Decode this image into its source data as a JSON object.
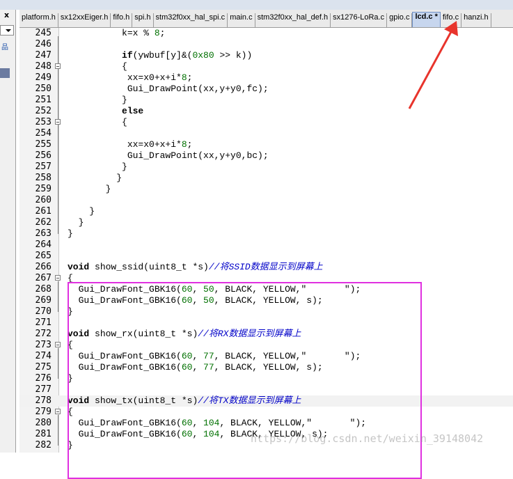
{
  "left_panel": {
    "close_glyph": "x",
    "icon_glyph": "品"
  },
  "tabs": [
    {
      "label": "platform.h",
      "active": false
    },
    {
      "label": "sx12xxEiger.h",
      "active": false
    },
    {
      "label": "fifo.h",
      "active": false
    },
    {
      "label": "spi.h",
      "active": false
    },
    {
      "label": "stm32f0xx_hal_spi.c",
      "active": false
    },
    {
      "label": "main.c",
      "active": false
    },
    {
      "label": "stm32f0xx_hal_def.h",
      "active": false
    },
    {
      "label": "sx1276-LoRa.c",
      "active": false
    },
    {
      "label": "gpio.c",
      "active": false
    },
    {
      "label": "lcd.c *",
      "active": true
    },
    {
      "label": "fifo.c",
      "active": false
    },
    {
      "label": "hanzi.h",
      "active": false
    }
  ],
  "lines": [
    {
      "n": "245",
      "fold": false,
      "t": [
        [
          "",
          "          k=x % "
        ],
        [
          "num",
          "8"
        ],
        [
          "",
          ";"
        ]
      ]
    },
    {
      "n": "246",
      "fold": false,
      "t": []
    },
    {
      "n": "247",
      "fold": false,
      "t": [
        [
          "",
          "          "
        ],
        [
          "kw",
          "if"
        ],
        [
          "",
          "(ywbuf[y]&("
        ],
        [
          "num",
          "0x80"
        ],
        [
          "",
          " >> k))"
        ]
      ]
    },
    {
      "n": "248",
      "fold": true,
      "t": [
        [
          "",
          "          {"
        ]
      ]
    },
    {
      "n": "249",
      "fold": false,
      "t": [
        [
          "",
          "           xx=x0+x+i*"
        ],
        [
          "num",
          "8"
        ],
        [
          "",
          ";"
        ]
      ]
    },
    {
      "n": "250",
      "fold": false,
      "t": [
        [
          "",
          "           Gui_DrawPoint(xx,y+y0,fc);"
        ]
      ]
    },
    {
      "n": "251",
      "fold": false,
      "t": [
        [
          "",
          "          }"
        ]
      ]
    },
    {
      "n": "252",
      "fold": false,
      "t": [
        [
          "",
          "          "
        ],
        [
          "kw",
          "else"
        ]
      ]
    },
    {
      "n": "253",
      "fold": true,
      "t": [
        [
          "",
          "          {"
        ]
      ]
    },
    {
      "n": "254",
      "fold": false,
      "t": []
    },
    {
      "n": "255",
      "fold": false,
      "t": [
        [
          "",
          "           xx=x0+x+i*"
        ],
        [
          "num",
          "8"
        ],
        [
          "",
          ";"
        ]
      ]
    },
    {
      "n": "256",
      "fold": false,
      "t": [
        [
          "",
          "           Gui_DrawPoint(xx,y+y0,bc);"
        ]
      ]
    },
    {
      "n": "257",
      "fold": false,
      "t": [
        [
          "",
          "          }"
        ]
      ]
    },
    {
      "n": "258",
      "fold": false,
      "t": [
        [
          "",
          "         }"
        ]
      ]
    },
    {
      "n": "259",
      "fold": false,
      "t": [
        [
          "",
          "       }"
        ]
      ]
    },
    {
      "n": "260",
      "fold": false,
      "t": []
    },
    {
      "n": "261",
      "fold": false,
      "t": [
        [
          "",
          "    }"
        ]
      ]
    },
    {
      "n": "262",
      "fold": false,
      "t": [
        [
          "",
          "  }"
        ]
      ]
    },
    {
      "n": "263",
      "fold": false,
      "t": [
        [
          "",
          "}"
        ]
      ]
    },
    {
      "n": "264",
      "fold": false,
      "t": []
    },
    {
      "n": "265",
      "fold": false,
      "t": []
    },
    {
      "n": "266",
      "fold": false,
      "t": [
        [
          "kw",
          "void"
        ],
        [
          "",
          " show_ssid(uint8_t *s)"
        ],
        [
          "cm",
          "//将SSID数据显示到屏幕上"
        ]
      ]
    },
    {
      "n": "267",
      "fold": true,
      "t": [
        [
          "",
          "{"
        ]
      ]
    },
    {
      "n": "268",
      "fold": false,
      "t": [
        [
          "",
          "  Gui_DrawFont_GBK16("
        ],
        [
          "num",
          "60"
        ],
        [
          "",
          ", "
        ],
        [
          "num",
          "50"
        ],
        [
          "",
          ", BLACK, YELLOW,\"       \");"
        ]
      ]
    },
    {
      "n": "269",
      "fold": false,
      "t": [
        [
          "",
          "  Gui_DrawFont_GBK16("
        ],
        [
          "num",
          "60"
        ],
        [
          "",
          ", "
        ],
        [
          "num",
          "50"
        ],
        [
          "",
          ", BLACK, YELLOW, s);"
        ]
      ]
    },
    {
      "n": "270",
      "fold": false,
      "t": [
        [
          "",
          "}"
        ]
      ]
    },
    {
      "n": "271",
      "fold": false,
      "t": []
    },
    {
      "n": "272",
      "fold": false,
      "t": [
        [
          "kw",
          "void"
        ],
        [
          "",
          " show_rx(uint8_t *s)"
        ],
        [
          "cm",
          "//将RX数据显示到屏幕上"
        ]
      ]
    },
    {
      "n": "273",
      "fold": true,
      "t": [
        [
          "",
          "{"
        ]
      ]
    },
    {
      "n": "274",
      "fold": false,
      "t": [
        [
          "",
          "  Gui_DrawFont_GBK16("
        ],
        [
          "num",
          "60"
        ],
        [
          "",
          ", "
        ],
        [
          "num",
          "77"
        ],
        [
          "",
          ", BLACK, YELLOW,\"       \");"
        ]
      ]
    },
    {
      "n": "275",
      "fold": false,
      "t": [
        [
          "",
          "  Gui_DrawFont_GBK16("
        ],
        [
          "num",
          "60"
        ],
        [
          "",
          ", "
        ],
        [
          "num",
          "77"
        ],
        [
          "",
          ", BLACK, YELLOW, s);"
        ]
      ]
    },
    {
      "n": "276",
      "fold": false,
      "t": [
        [
          "",
          "}"
        ]
      ]
    },
    {
      "n": "277",
      "fold": false,
      "t": []
    },
    {
      "n": "278",
      "fold": false,
      "cur": true,
      "t": [
        [
          "kw",
          "void"
        ],
        [
          "",
          " show_tx(uint8_t *s)"
        ],
        [
          "cm",
          "//将TX数据显示到屏幕上"
        ]
      ]
    },
    {
      "n": "279",
      "fold": true,
      "t": [
        [
          "",
          "{"
        ]
      ]
    },
    {
      "n": "280",
      "fold": false,
      "t": [
        [
          "",
          "  Gui_DrawFont_GBK16("
        ],
        [
          "num",
          "60"
        ],
        [
          "",
          ", "
        ],
        [
          "num",
          "104"
        ],
        [
          "",
          ", BLACK, YELLOW,\"       \");"
        ]
      ]
    },
    {
      "n": "281",
      "fold": false,
      "t": [
        [
          "",
          "  Gui_DrawFont_GBK16("
        ],
        [
          "num",
          "60"
        ],
        [
          "",
          ", "
        ],
        [
          "num",
          "104"
        ],
        [
          "",
          ", BLACK, YELLOW, s);"
        ]
      ]
    },
    {
      "n": "282",
      "fold": false,
      "t": [
        [
          "",
          "}"
        ]
      ]
    }
  ],
  "watermark": "https://blog.csdn.net/weixin_39148042",
  "colors": {
    "highlight_box": "#e030e0",
    "arrow": "#e8342c",
    "active_tab": "#c7d6ee"
  }
}
